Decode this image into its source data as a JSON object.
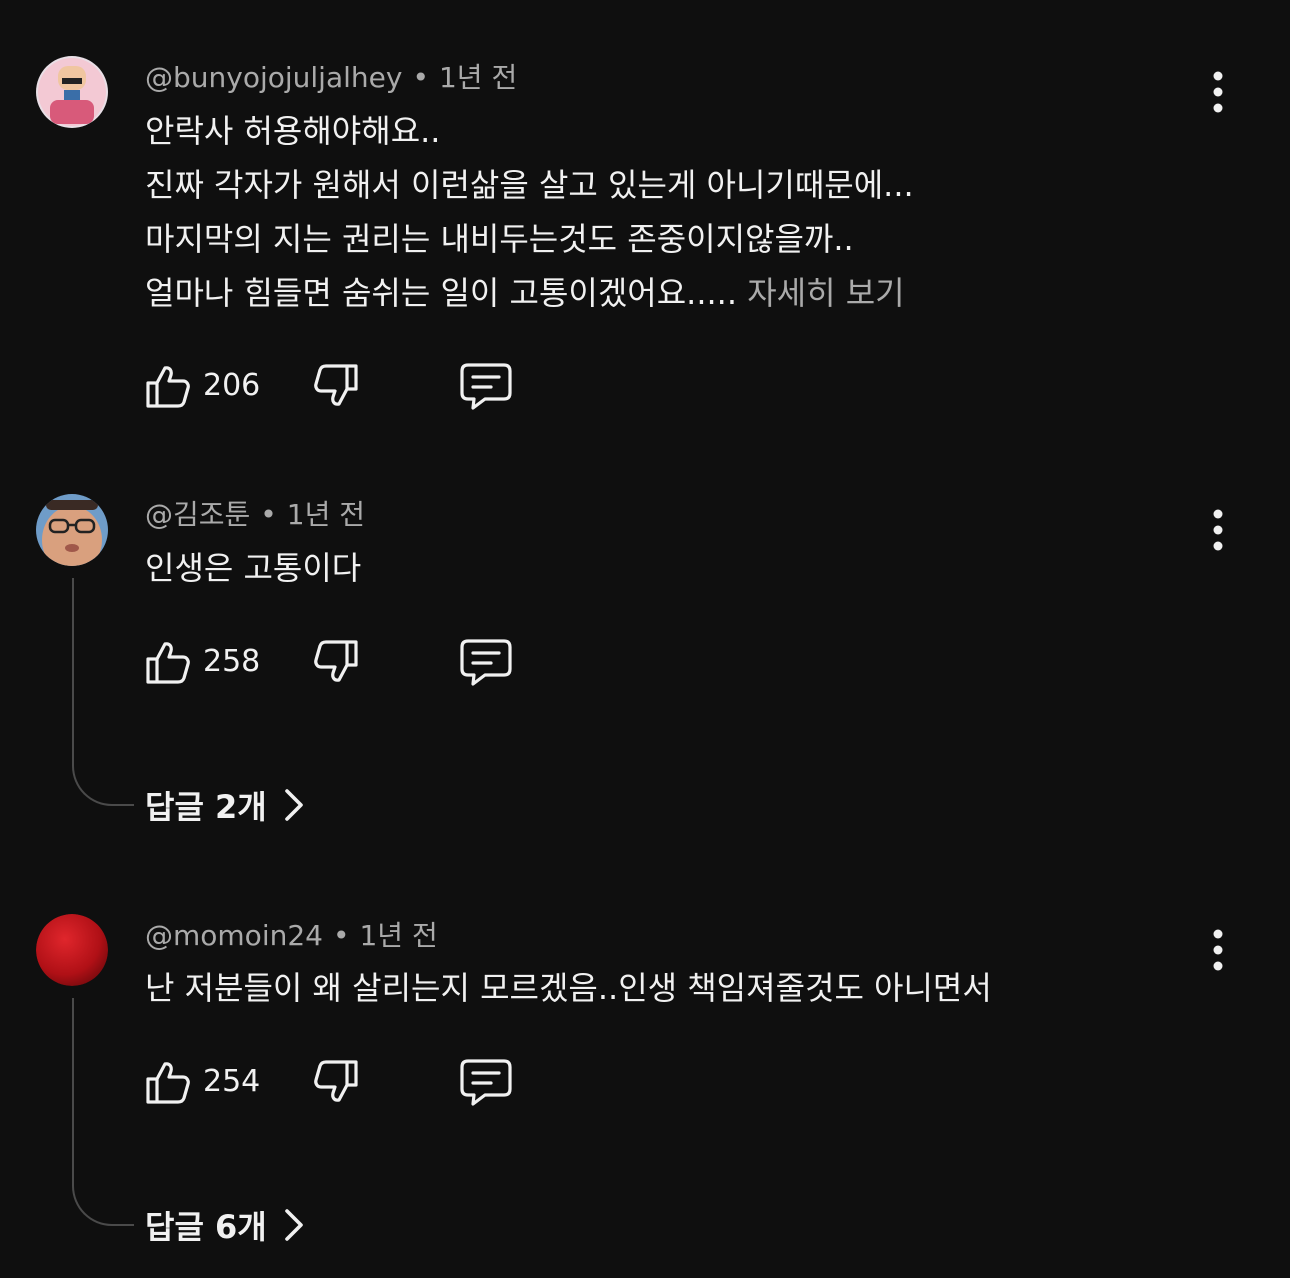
{
  "comments": [
    {
      "author": "@bunyojojuljalhey",
      "time": "1년 전",
      "lines": [
        "안락사 허용해야해요..",
        "진짜 각자가 원해서 이런삶을 살고 있는게 아니기때문에...",
        "마지막의 지는 권리는 내비두는것도 존중이지않을까..",
        "얼마나 힘들면 숨쉬는 일이 고통이겠어요....."
      ],
      "more_label": "자세히 보기",
      "likes": "206",
      "avatar_color": "#c87a8a"
    },
    {
      "author": "@김조툰",
      "time": "1년 전",
      "lines": [
        "인생은 고통이다"
      ],
      "likes": "258",
      "replies_label": "답글 2개",
      "avatar_color": "#b07a60"
    },
    {
      "author": "@momoin24",
      "time": "1년 전",
      "lines": [
        "난 저분들이 왜 살리는지 모르겠음..인생 책임져줄것도 아니면서"
      ],
      "likes": "254",
      "replies_label": "답글 6개",
      "avatar_color": "#c0141a"
    }
  ],
  "icons": {
    "like": "thumbs-up-icon",
    "dislike": "thumbs-down-icon",
    "reply": "comment-icon",
    "menu": "more-vert-icon",
    "chevron": "chevron-right-icon"
  },
  "colors": {
    "background": "#0f0f0f",
    "text_primary": "#f1f1f1",
    "text_secondary": "#aaaaaa",
    "thread_line": "#4a4a4a"
  }
}
